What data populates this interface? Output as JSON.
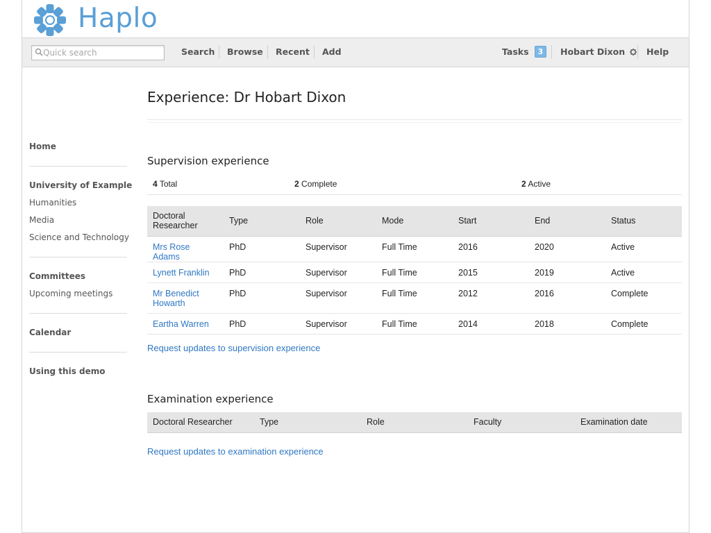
{
  "app": {
    "name": "Haplo",
    "brand_color": "#5a9fd6"
  },
  "search": {
    "placeholder": "Quick search",
    "value": ""
  },
  "nav": {
    "search": "Search",
    "browse": "Browse",
    "recent": "Recent",
    "add": "Add",
    "tasks": "Tasks",
    "tasks_count": "3",
    "user": "Hobart Dixon",
    "help": "Help"
  },
  "sidebar": {
    "home": "Home",
    "org": "University of Example",
    "faculties": [
      "Humanities",
      "Media",
      "Science and Technology"
    ],
    "committees": "Committees",
    "upcoming": "Upcoming meetings",
    "calendar": "Calendar",
    "demo": "Using this demo"
  },
  "page": {
    "title": "Experience: Dr Hobart Dixon"
  },
  "supervision": {
    "title": "Supervision experience",
    "stats": {
      "total_num": "4",
      "total_label": "Total",
      "complete_num": "2",
      "complete_label": "Complete",
      "active_num": "2",
      "active_label": "Active"
    },
    "columns": [
      "Doctoral Researcher",
      "Type",
      "Role",
      "Mode",
      "Start",
      "End",
      "Status"
    ],
    "rows": [
      {
        "name": "Mrs Rose Adams",
        "type": "PhD",
        "role": "Supervisor",
        "mode": "Full Time",
        "start": "2016",
        "end": "2020",
        "status": "Active"
      },
      {
        "name": "Lynett Franklin",
        "type": "PhD",
        "role": "Supervisor",
        "mode": "Full Time",
        "start": "2015",
        "end": "2019",
        "status": "Active"
      },
      {
        "name": "Mr Benedict Howarth",
        "type": "PhD",
        "role": "Supervisor",
        "mode": "Full Time",
        "start": "2012",
        "end": "2016",
        "status": "Complete"
      },
      {
        "name": "Eartha Warren",
        "type": "PhD",
        "role": "Supervisor",
        "mode": "Full Time",
        "start": "2014",
        "end": "2018",
        "status": "Complete"
      }
    ],
    "request_link": "Request updates to supervision experience"
  },
  "examination": {
    "title": "Examination experience",
    "columns": [
      "Doctoral Researcher",
      "Type",
      "Role",
      "Faculty",
      "Examination date"
    ],
    "request_link": "Request updates to examination experience"
  }
}
